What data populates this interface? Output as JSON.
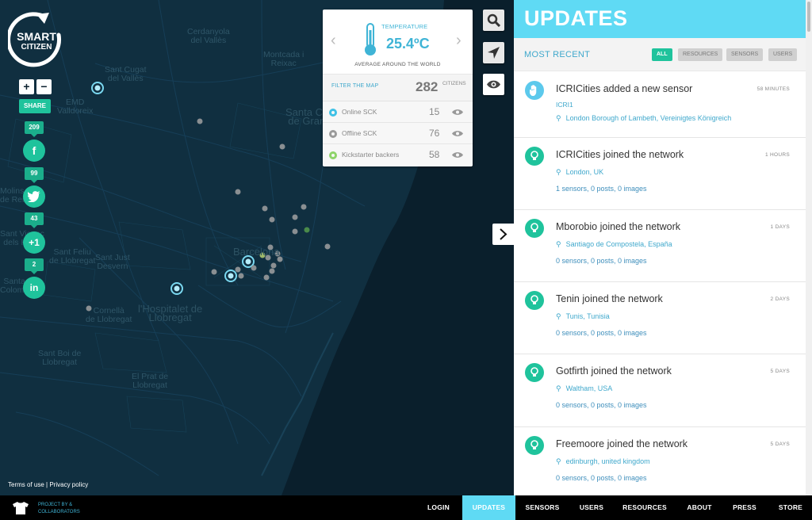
{
  "app": {
    "brand_line1": "SMART",
    "brand_line2": "CITIZEN"
  },
  "map": {
    "places": [
      "Cerdanyola",
      "del Vallès",
      "Montcada i",
      "Reixac",
      "Sant Cugat",
      "del Vallès",
      "EMD",
      "Valldoreix",
      "Santa Coloma",
      "de Gramenet",
      "Molins",
      "de Rei",
      "Sant Vicenç",
      "dels Horts",
      "Sant Feliu",
      "de Llobregat",
      "Sant Just",
      "Desvern",
      "Santa",
      "Coloma",
      "Barcelona",
      "Cornellà",
      "de Llobregat",
      "l'Hospitalet de",
      "Llobregat",
      "Sant Boi de",
      "Llobregat",
      "El Prat de",
      "Llobregat"
    ]
  },
  "toolbar": {
    "zoom_in": "+",
    "zoom_out": "−",
    "share": "SHARE",
    "social": [
      {
        "count": "209",
        "icon": "facebook-icon",
        "glyph": "f"
      },
      {
        "count": "99",
        "icon": "twitter-icon",
        "glyph": ""
      },
      {
        "count": "43",
        "icon": "googleplus-icon",
        "glyph": "+1"
      },
      {
        "count": "2",
        "icon": "linkedin-icon",
        "glyph": "in"
      }
    ]
  },
  "temperature": {
    "label": "TEMPERATURE",
    "value": "25.4ºC",
    "subtitle": "AVERAGE AROUND THE WORLD"
  },
  "filter": {
    "label": "FILTER THE MAP",
    "citizens_count": "282",
    "citizens_label": "CITIZENS",
    "rows": [
      {
        "label": "Online SCK",
        "count": "15",
        "color": "#3fc1e6"
      },
      {
        "label": "Offline SCK",
        "count": "76",
        "color": "#9a9a9a"
      },
      {
        "label": "Kickstarter backers",
        "count": "58",
        "color": "#8ed46a"
      }
    ]
  },
  "updates": {
    "title": "UPDATES",
    "subtitle": "MOST RECENT",
    "filters": [
      "ALL",
      "RESOURCES",
      "SENSORS",
      "USERS"
    ],
    "items": [
      {
        "title": "ICRICities added a new sensor",
        "time": "58 MINUTES",
        "extra": "ICRI1",
        "location": "London Borough of Lambeth, Vereinigtes Königreich",
        "stats": "",
        "icon_color": "#5cc9ec",
        "icon": "hand-icon"
      },
      {
        "title": "ICRICities joined the network",
        "time": "1 HOURS",
        "extra": "",
        "location": "London, UK",
        "stats": "1 sensors, 0 posts, 0 images",
        "icon_color": "#1fc39c",
        "icon": "bulb-icon"
      },
      {
        "title": "Mborobio joined the network",
        "time": "1 DAYS",
        "extra": "",
        "location": "Santiago de Compostela, España",
        "stats": "0 sensors, 0 posts, 0 images",
        "icon_color": "#1fc39c",
        "icon": "bulb-icon"
      },
      {
        "title": "Tenin joined the network",
        "time": "2 DAYS",
        "extra": "",
        "location": "Tunis, Tunisia",
        "stats": "0 sensors, 0 posts, 0 images",
        "icon_color": "#1fc39c",
        "icon": "bulb-icon"
      },
      {
        "title": "Gotfirth joined the network",
        "time": "5 DAYS",
        "extra": "",
        "location": "Waltham, USA",
        "stats": "0 sensors, 0 posts, 0 images",
        "icon_color": "#1fc39c",
        "icon": "bulb-icon"
      },
      {
        "title": "Freemoore joined the network",
        "time": "5 DAYS",
        "extra": "",
        "location": "edinburgh, united kingdom",
        "stats": "0 sensors, 0 posts, 0 images",
        "icon_color": "#1fc39c",
        "icon": "bulb-icon"
      }
    ]
  },
  "footer": {
    "terms": "Terms of use",
    "separator": "|",
    "privacy": "Privacy policy",
    "project_line1": "PROJECT BY &",
    "project_line2": "COLLABORATORS"
  },
  "nav": {
    "items": [
      "LOGIN",
      "UPDATES",
      "SENSORS",
      "USERS",
      "RESOURCES",
      "ABOUT",
      "PRESS",
      "STORE"
    ],
    "active": "UPDATES"
  },
  "colors": {
    "accent": "#5fdaf4",
    "green": "#1fc39c",
    "map_bg": "#0f2b3b"
  }
}
